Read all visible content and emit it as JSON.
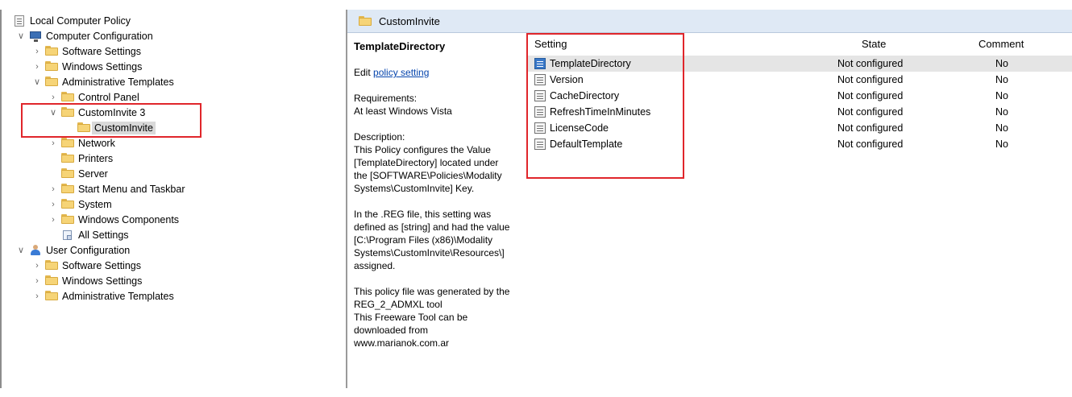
{
  "tree": {
    "root": "Local Computer Policy",
    "items": [
      {
        "label": "Computer Configuration"
      },
      {
        "label": "Software Settings"
      },
      {
        "label": "Windows Settings"
      },
      {
        "label": "Administrative Templates"
      },
      {
        "label": "Control Panel"
      },
      {
        "label": "CustomInvite 3"
      },
      {
        "label": "CustomInvite"
      },
      {
        "label": "Network"
      },
      {
        "label": "Printers"
      },
      {
        "label": "Server"
      },
      {
        "label": "Start Menu and Taskbar"
      },
      {
        "label": "System"
      },
      {
        "label": "Windows Components"
      },
      {
        "label": "All Settings"
      },
      {
        "label": "User Configuration"
      },
      {
        "label": "Software Settings"
      },
      {
        "label": "Windows Settings"
      },
      {
        "label": "Administrative Templates"
      }
    ]
  },
  "header": {
    "title": "CustomInvite"
  },
  "description": {
    "policy_name": "TemplateDirectory",
    "edit_prefix": "Edit ",
    "edit_link": "policy setting",
    "requirements": "Requirements:\nAt least Windows Vista",
    "desc": "Description:\nThis Policy configures the Value\n[TemplateDirectory] located under\nthe [SOFTWARE\\Policies\\Modality\nSystems\\CustomInvite] Key.",
    "reg_info": "In the .REG file, this setting was\ndefined as [string] and had the value\n[C:\\Program Files (x86)\\Modality\nSystems\\CustomInvite\\Resources\\]\nassigned.",
    "generated": "This policy file was generated by the\nREG_2_ADMXL tool\nThis Freeware Tool can be\ndownloaded from\nwww.marianok.com.ar"
  },
  "list": {
    "columns": {
      "setting": "Setting",
      "state": "State",
      "comment": "Comment"
    },
    "rows": [
      {
        "setting": "TemplateDirectory",
        "state": "Not configured",
        "comment": "No"
      },
      {
        "setting": "Version",
        "state": "Not configured",
        "comment": "No"
      },
      {
        "setting": "CacheDirectory",
        "state": "Not configured",
        "comment": "No"
      },
      {
        "setting": "RefreshTimeInMinutes",
        "state": "Not configured",
        "comment": "No"
      },
      {
        "setting": "LicenseCode",
        "state": "Not configured",
        "comment": "No"
      },
      {
        "setting": "DefaultTemplate",
        "state": "Not configured",
        "comment": "No"
      }
    ]
  },
  "colors": {
    "highlight_box": "#e0262b",
    "header_bg": "#dfe9f5",
    "selection": "#e5e5e5",
    "link": "#0645ad"
  }
}
